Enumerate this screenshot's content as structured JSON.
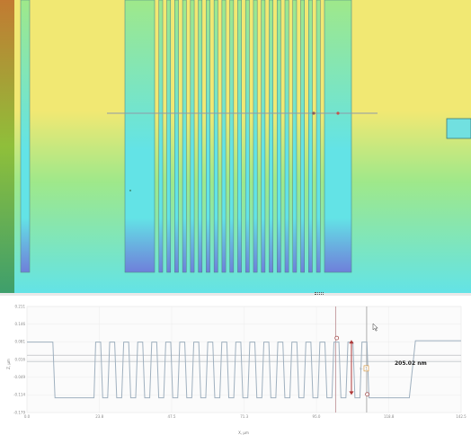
{
  "viewer": {
    "colors": {
      "top_yellow": "#f1e873",
      "mid_green": "#9fe88a",
      "low_cyan": "#63e3e6",
      "deep_blue": "#6f7fda",
      "scan_line": "#8f9aa8",
      "profile_line": "#9fb0bf",
      "measure_arrow": "#b03a3a",
      "cursor_line": "#b9878c"
    },
    "icons": [
      "resize-grip-icon",
      "mouse-pointer-icon",
      "ruler-icon"
    ]
  },
  "chart_data": {
    "type": "line",
    "title": "",
    "xlabel": "X, μm",
    "ylabel": "Z, μm",
    "xlim": [
      0,
      142.5
    ],
    "ylim": [
      -0.179,
      0.211
    ],
    "x_ticks": [
      "0.0",
      "23.8",
      "47.5",
      "71.3",
      "95.0",
      "118.8",
      "142.5"
    ],
    "y_ticks": [
      "0.211",
      "0.146",
      "0.081",
      "0.016",
      "-0.049",
      "-0.114",
      "-0.179"
    ],
    "profile": {
      "high_level": 0.08,
      "low_level": -0.125,
      "plateaus": [
        {
          "from": 0.0,
          "to": 8.5,
          "level": 0.08
        },
        {
          "from": 9.2,
          "to": 22.0,
          "level": -0.125
        },
        {
          "from": 118.5,
          "to": 125.5,
          "level": -0.125
        },
        {
          "from": 127.5,
          "to": 142.5,
          "level": 0.085
        }
      ],
      "grating": {
        "start": 22.0,
        "end": 118.5,
        "period": 4.6,
        "duty": 0.5
      }
    },
    "cursors_x": [
      101.3,
      111.5
    ],
    "reference_lines_y": [
      0.032,
      0.009
    ],
    "markers": [
      {
        "x": 101.7,
        "y": 0.095
      },
      {
        "x": 111.7,
        "y": -0.112
      }
    ],
    "measurement": {
      "value": "205.02 nm",
      "bracket": "⊢",
      "index": "1"
    }
  }
}
